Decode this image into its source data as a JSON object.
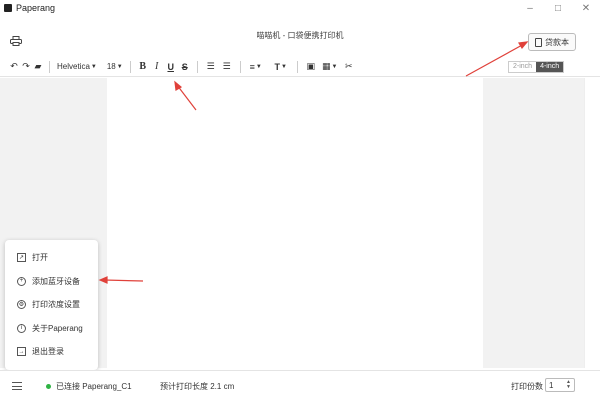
{
  "app": {
    "name": "Paperang"
  },
  "window": {
    "minimize": "–",
    "maximize": "□",
    "close": "✕"
  },
  "header": {
    "title": "喵喵机 - 口袋便携打印机",
    "notebook_label": "贷款本"
  },
  "toolbar": {
    "font_family": "Helvetica",
    "font_size": "18",
    "bold": "B",
    "italic": "I",
    "underline": "U",
    "strike": "S",
    "width_options": [
      "2-inch",
      "4-inch"
    ],
    "width_selected": "4-inch"
  },
  "menu": {
    "items": [
      {
        "label": "打开",
        "icon": "open-file-icon"
      },
      {
        "label": "添加蓝牙设备",
        "icon": "add-circle-icon"
      },
      {
        "label": "打印浓度设置",
        "icon": "settings-gear-icon"
      },
      {
        "label": "关于Paperang",
        "icon": "info-icon"
      },
      {
        "label": "退出登录",
        "icon": "logout-icon"
      }
    ]
  },
  "status": {
    "connected_text": "已连接 Paperang_C1",
    "length_text": "预计打印长度 2.1 cm",
    "copies_label": "打印份数",
    "copies_value": "1"
  },
  "colors": {
    "accent_arrow": "#e0413a",
    "connected": "#2fb344"
  }
}
